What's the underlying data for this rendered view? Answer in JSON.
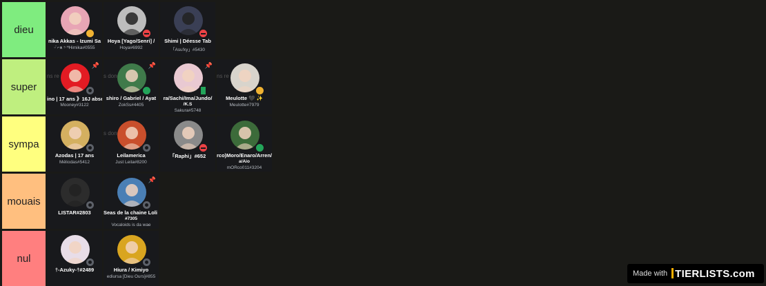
{
  "tiers": [
    {
      "label": "dieu",
      "color": "#7fec7f",
      "items": [
        {
          "name": "nika Akkas - Izumi Sa",
          "tag": "ᵕ̈ ⌐ᴥ ⁵ ᴴHimika#0555",
          "status": "idle",
          "avatar": "pink-hair-avatar",
          "bg": "#e8a5b5"
        },
        {
          "name": "Hoya [Yago/Senri] /",
          "tag": "Hoya#6992",
          "status": "dnd",
          "avatar": "grayscale-avatar",
          "bg": "#bdbdbd"
        },
        {
          "name": "Shimi | Déesse Tab",
          "tag": "「Asu'ky」#5430",
          "status": "dnd",
          "avatar": "dark-anime-avatar",
          "bg": "#3a3f55"
        }
      ]
    },
    {
      "label": "super",
      "color": "#bfef7f",
      "items": [
        {
          "name": "ino | 17 ans 》16J abse",
          "tag": "Mooney#3122",
          "status": "offline",
          "avatar": "mooney-logo-avatar",
          "bg": "#e31b23",
          "bgtext": "ns re",
          "pin": true
        },
        {
          "name": "shiro / Gabriel / Ayat",
          "tag": "ZokSs#4405",
          "status": "online",
          "avatar": "green-hair-avatar",
          "bg": "#3f7a4a",
          "bgtext": "s donc",
          "pin": true
        },
        {
          "name": "ra/Sachi/Ima/Jundo/",
          "tag": "/K.S",
          "tag2": "Sakura#5748",
          "status": "mobile",
          "avatar": "pink-anime-avatar",
          "bg": "#e9c9d2",
          "pin": true
        },
        {
          "name": "Meulotte 🖤 ✨",
          "tag": "Meulotte#7979",
          "status": "idle",
          "avatar": "leaf-sketch-avatar",
          "bg": "#d8d4cc",
          "bgtext": "ns re"
        }
      ]
    },
    {
      "label": "sympa",
      "color": "#ffff7f",
      "items": [
        {
          "name": "Azodas | 17 ans",
          "tag": "Méliodas#5412",
          "status": "offline",
          "avatar": "blonde-anime-avatar",
          "bg": "#d4b060"
        },
        {
          "name": "Leilamerica",
          "tag": "Just Leila#8200",
          "status": "offline",
          "avatar": "cartoon-avatar",
          "bg": "#c94f2c",
          "bgtext": "s donc"
        },
        {
          "name": "「Raphi」#652",
          "tag": "",
          "status": "dnd",
          "avatar": "gray-creature-avatar",
          "bg": "#8a8a8a"
        },
        {
          "name": "rco)Moro/Enaro/Arren/",
          "tag": "a/Aio",
          "tag2": "mORco011#3204",
          "status": "online",
          "avatar": "pixel-soldier-avatar",
          "bg": "#3c6b3a"
        }
      ]
    },
    {
      "label": "mouais",
      "color": "#ffbf7f",
      "items": [
        {
          "name": "LISTAR#2803",
          "tag": "",
          "status": "offline",
          "avatar": "dark-figure-avatar",
          "bg": "#2c2c2c"
        },
        {
          "name": "Seas de la chaine Loli & C",
          "tag": "#7305",
          "tag2": "Vocaloids is da wae",
          "status": "offline",
          "avatar": "blue-hair-avatar",
          "bg": "#4a7fb5",
          "pin": true
        }
      ]
    },
    {
      "label": "nul",
      "color": "#ff7f7f",
      "items": [
        {
          "name": "†-Azuky-†#2489",
          "tag": "",
          "status": "offline",
          "avatar": "white-hair-avatar",
          "bg": "#e8dde8"
        },
        {
          "name": "Hiura / Kimiyo",
          "tag": "ediursa [Dieu Ours]#855",
          "status": "offline",
          "avatar": "sunflower-avatar",
          "bg": "#d9a520"
        }
      ]
    }
  ],
  "watermark": {
    "made_with": "Made with",
    "brand": "TIERLISTS.com"
  }
}
